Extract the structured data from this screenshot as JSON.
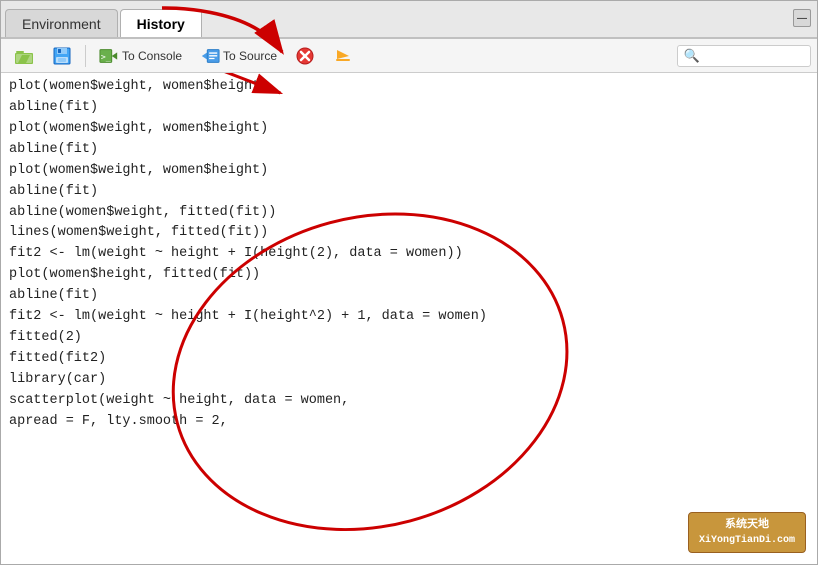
{
  "tabs": [
    {
      "id": "environment",
      "label": "Environment",
      "active": false
    },
    {
      "id": "history",
      "label": "History",
      "active": true
    }
  ],
  "toolbar": {
    "load_label": "",
    "save_label": "",
    "to_console_label": "To Console",
    "to_source_label": "To Source",
    "delete_label": "",
    "run_label": "",
    "search_placeholder": "🔍"
  },
  "code_lines": [
    "plot(women$weight, women$height)",
    "abline(fit)",
    "plot(women$weight, women$height)",
    "abline(fit)",
    "plot(women$weight, women$height)",
    "abline(fit)",
    "abline(women$weight, fitted(fit))",
    "lines(women$weight, fitted(fit))",
    "fit2 <- lm(weight ~ height + I(height(2), data = women))",
    "plot(women$height, fitted(fit))",
    "abline(fit)",
    "fit2 <- lm(weight ~ height + I(height^2) + 1, data = women)",
    "fitted(2)",
    "fitted(fit2)",
    "library(car)",
    "scatterplot(weight ~ height, data = women,",
    "apread = F, lty.smooth = 2,"
  ],
  "watermark": {
    "line1": "系统天地",
    "line2": "XiYongTianDi.com"
  },
  "annotation_arrow": {
    "description": "Red arrow from History tab pointing to To Source button, with circular annotation on code area"
  }
}
